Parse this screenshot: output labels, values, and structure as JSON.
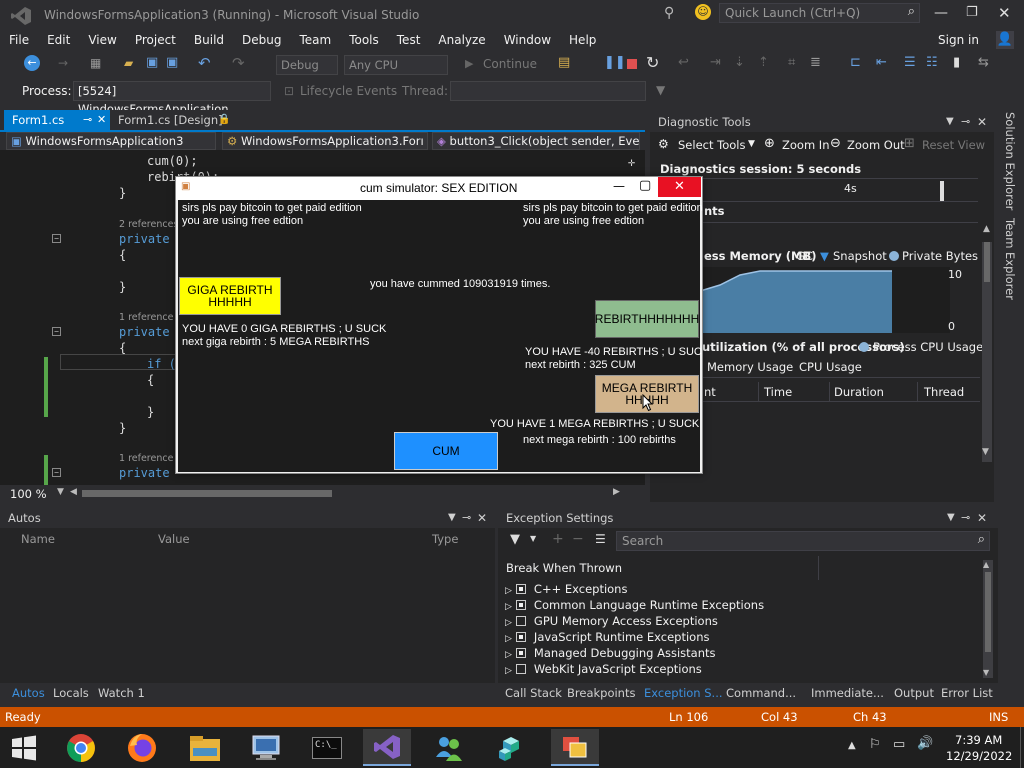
{
  "vs": {
    "title": "WindowsFormsApplication3 (Running) - Microsoft Visual Studio",
    "quick_launch": "Quick Launch (Ctrl+Q)",
    "menu": [
      "File",
      "Edit",
      "View",
      "Project",
      "Build",
      "Debug",
      "Team",
      "Tools",
      "Test",
      "Analyze",
      "Window",
      "Help"
    ],
    "sign_in": "Sign in",
    "toolbar": {
      "config": "Debug",
      "platform": "Any CPU",
      "continue": "Continue",
      "process_label": "Process:",
      "process_value": "[5524] WindowsFormsApplication",
      "lifecycle": "Lifecycle Events",
      "thread_label": "Thread:"
    },
    "tabs": [
      "Form1.cs",
      "Form1.cs [Design]"
    ],
    "nav": {
      "project": "WindowsFormsApplication3",
      "class": "WindowsFormsApplication3.Forı",
      "member": "button3_Click(object sender, Eve"
    },
    "code": {
      "l1": "cum(0);",
      "l2": "rebirt(0);",
      "l3": "}",
      "ref1": "2 references",
      "l4_kw": "private",
      "l5": "{",
      "l6": "}",
      "ref2": "1 reference",
      "l7_kw": "private",
      "l8": "{",
      "l9_kw": "if (",
      "l10": "{",
      "l11": "}",
      "l12": "}",
      "ref3": "1 reference",
      "l13_kw": "private"
    },
    "zoom": "100 %",
    "diagnostic": {
      "title": "Diagnostic Tools",
      "select_tools": "Select Tools",
      "zoom_in": "Zoom In",
      "zoom_out": "Zoom Out",
      "reset_view": "Reset View",
      "session": "Diagnostics session: 5 seconds",
      "tick": "4s",
      "events_frag": "nts",
      "memory_title": "ess Memory (MB)",
      "gc": "GC",
      "snapshot": "Snapshot",
      "private_bytes": "Private Bytes",
      "ymax": "10",
      "ymin": "0",
      "cpu_title": "utilization (% of all processors)",
      "cpu_legend": "Process CPU Usage",
      "tab_memory": "Memory Usage",
      "tab_cpu": "CPU Usage",
      "col_event": "nt",
      "col_time": "Time",
      "col_duration": "Duration",
      "col_thread": "Thread"
    },
    "side_tabs": [
      "Solution Explorer",
      "Team Explorer"
    ],
    "autos": {
      "title": "Autos",
      "col_name": "Name",
      "col_value": "Value",
      "col_type": "Type",
      "tabs": [
        "Autos",
        "Locals",
        "Watch 1"
      ]
    },
    "exceptions": {
      "title": "Exception Settings",
      "search": "Search",
      "header": "Break When Thrown",
      "items": [
        {
          "label": "C++ Exceptions",
          "checked": true
        },
        {
          "label": "Common Language Runtime Exceptions",
          "checked": true
        },
        {
          "label": "GPU Memory Access Exceptions",
          "checked": false
        },
        {
          "label": "JavaScript Runtime Exceptions",
          "checked": true
        },
        {
          "label": "Managed Debugging Assistants",
          "checked": true
        },
        {
          "label": "WebKit JavaScript Exceptions",
          "checked": false
        }
      ],
      "tabs": [
        "Call Stack",
        "Breakpoints",
        "Exception S...",
        "Command...",
        "Immediate...",
        "Output",
        "Error List"
      ]
    },
    "status": {
      "ready": "Ready",
      "ln": "Ln 106",
      "col": "Col 43",
      "ch": "Ch 43",
      "ins": "INS"
    }
  },
  "app": {
    "title": "cum simulator: SEX EDITION",
    "pay_left": "sirs pls pay bitcoin to  get paid edition",
    "free_left": "you are using free edtion",
    "pay_right": "sirs pls pay bitcoin to  get paid edition",
    "free_right": "you are using free edtion",
    "counter": "you have cummed 109031919 times.",
    "giga_button": "GIGA REBIRTHHHHHH",
    "giga_status": "YOU HAVE  0 GIGA REBIRTHS ; U SUCK",
    "giga_next": "next giga rebirth : 5 MEGA REBIRTHS",
    "rebirth_button": "REBIRTHHHHHHH",
    "rebirth_status": "YOU HAVE  -40 REBIRTHS ; U SUC",
    "rebirth_next": "next rebirth : 325 CUM",
    "mega_button": "MEGA REBIRTHHHHHH",
    "mega_status": "YOU HAVE  1 MEGA REBIRTHS ; U SUCK",
    "mega_next": "next mega rebirth : 100 rebirths",
    "cum_button": "CUM",
    "colors": {
      "giga": "#ffff00",
      "rebirth": "#8fbc8f",
      "mega": "#d2b48c",
      "cum": "#1e90ff",
      "background": "#1c1c1c"
    }
  },
  "taskbar": {
    "time": "7:39 AM",
    "date": "12/29/2022",
    "icons": [
      "start-icon",
      "chrome-icon",
      "firefox-icon",
      "file-explorer-icon",
      "network-icon",
      "terminal-icon",
      "visual-studio-icon",
      "people-icon",
      "cubes-icon",
      "app-window-icon"
    ]
  }
}
